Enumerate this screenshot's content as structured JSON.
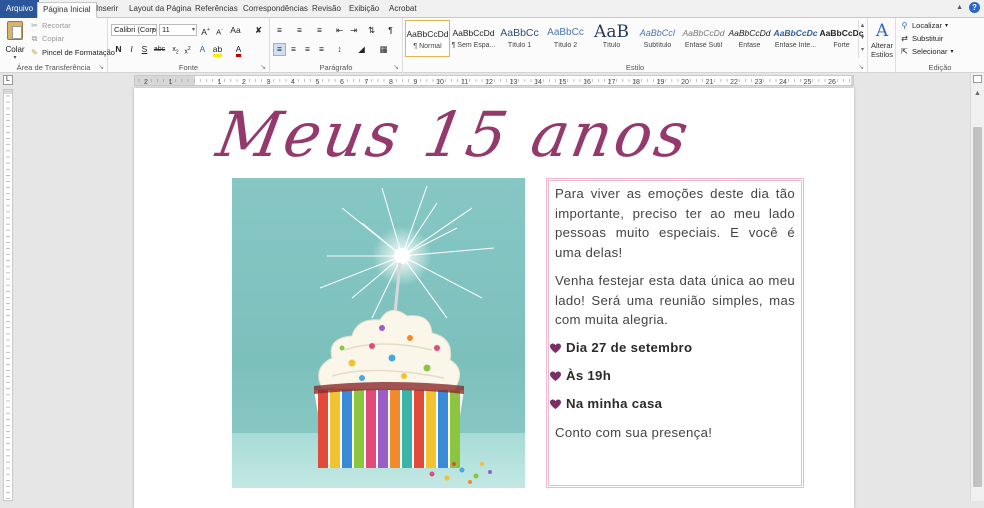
{
  "tabs": [
    {
      "label": "Arquivo",
      "file": true
    },
    {
      "label": "Página Inicial",
      "active": true
    },
    {
      "label": "Inserir"
    },
    {
      "label": "Layout da Página"
    },
    {
      "label": "Referências"
    },
    {
      "label": "Correspondências"
    },
    {
      "label": "Revisão"
    },
    {
      "label": "Exibição"
    },
    {
      "label": "Acrobat"
    }
  ],
  "clipboard": {
    "paste_label": "Colar",
    "cut_label": "Recortar",
    "copy_label": "Copiar",
    "format_painter_label": "Pincel de Formatação",
    "group_label": "Área de Transferência"
  },
  "font": {
    "family": "Calibri (Corp",
    "size": "11",
    "group_label": "Fonte"
  },
  "paragraph": {
    "group_label": "Parágrafo"
  },
  "styles": {
    "group_label": "Estilo",
    "items": [
      {
        "preview": "AaBbCcDd",
        "name": "¶ Normal",
        "selected": true
      },
      {
        "preview": "AaBbCcDd",
        "name": "¶ Sem Espa..."
      },
      {
        "preview": "AaBbCc",
        "name": "Título 1"
      },
      {
        "preview": "AaBbCc",
        "name": "Título 2"
      },
      {
        "preview": "AaB",
        "name": "Título"
      },
      {
        "preview": "AaBbCcI",
        "name": "Subtítulo"
      },
      {
        "preview": "AaBbCcDd",
        "name": "Ênfase Sutil"
      },
      {
        "preview": "AaBbCcDd",
        "name": "Ênfase"
      },
      {
        "preview": "AaBbCcDc",
        "name": "Ênfase Inte..."
      },
      {
        "preview": "AaBbCcDc",
        "name": "Forte"
      }
    ],
    "change_styles_label_1": "Alterar",
    "change_styles_label_2": "Estilos"
  },
  "editing": {
    "find_label": "Localizar",
    "replace_label": "Substituir",
    "select_label": "Selecionar",
    "group_label": "Edição"
  },
  "ruler_numbers": [
    "2",
    "1",
    "1",
    "2",
    "3",
    "4",
    "5",
    "6",
    "7",
    "8",
    "9",
    "10",
    "11",
    "12",
    "13",
    "14",
    "15",
    "16",
    "17",
    "18",
    "19",
    "20",
    "21",
    "22",
    "23",
    "24",
    "25",
    "26",
    "27"
  ],
  "document": {
    "title": "Meus 15 anos",
    "para1": "Para viver as emoções deste dia tão importante, preciso ter ao meu lado pessoas muito especiais. E você é uma delas!",
    "para2": "Venha festejar esta data única ao meu lado! Será uma reunião simples, mas com muita alegria.",
    "bullets": [
      "Dia 27 de setembro",
      "Às 19h",
      "Na minha casa"
    ],
    "closing": "Conto com sua presença!"
  },
  "colors": {
    "title": "#94396c",
    "heart": "#7a2f66",
    "textbox_border": "#f2b8d0",
    "word_blue": "#2b579a"
  }
}
